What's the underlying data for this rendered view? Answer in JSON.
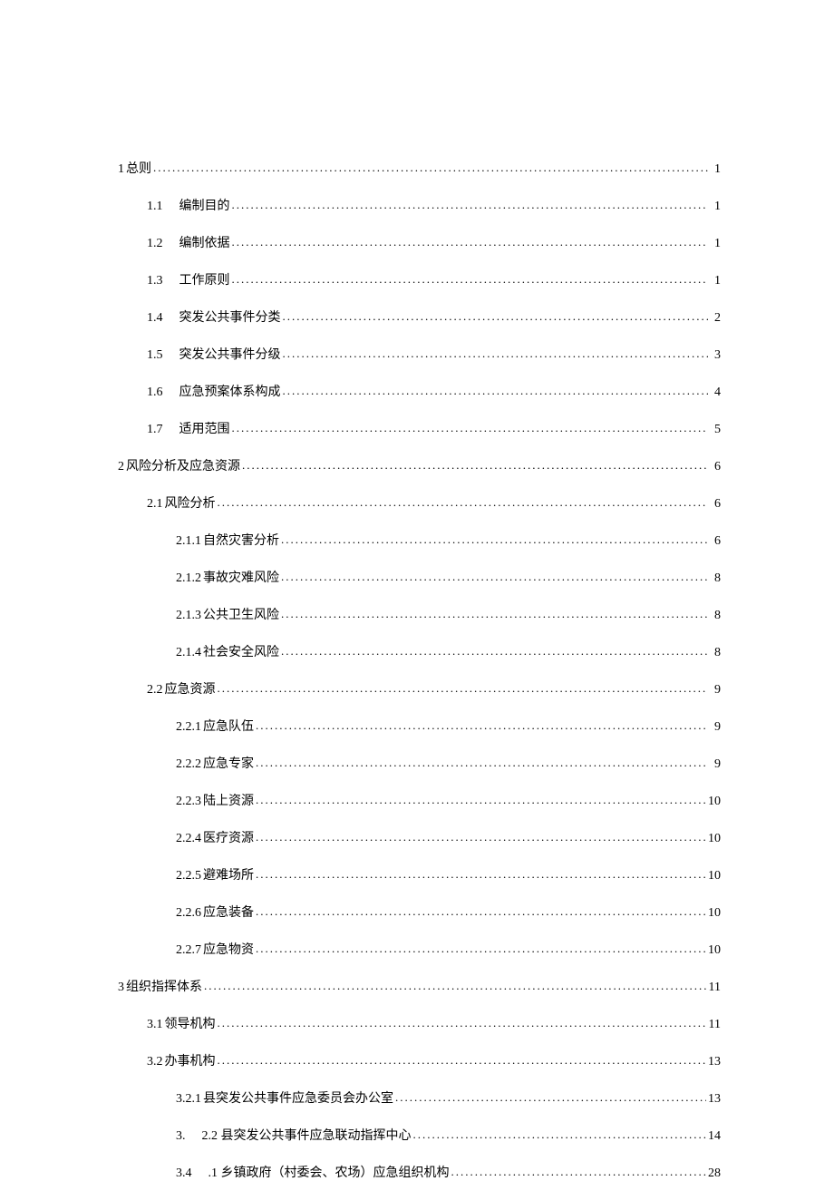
{
  "toc": [
    {
      "indent": 0,
      "num": "1",
      "title": "总则",
      "page": "1",
      "gap": "small"
    },
    {
      "indent": 1,
      "num": "1.1",
      "title": "编制目的",
      "page": "1",
      "gap": "wide"
    },
    {
      "indent": 1,
      "num": "1.2",
      "title": "编制依据",
      "page": "1",
      "gap": "wide"
    },
    {
      "indent": 1,
      "num": "1.3",
      "title": "工作原则",
      "page": "1",
      "gap": "wide"
    },
    {
      "indent": 1,
      "num": "1.4",
      "title": "突发公共事件分类",
      "page": "2",
      "gap": "wide"
    },
    {
      "indent": 1,
      "num": "1.5",
      "title": "突发公共事件分级",
      "page": "3",
      "gap": "wide"
    },
    {
      "indent": 1,
      "num": "1.6",
      "title": "应急预案体系构成",
      "page": "4",
      "gap": "wide"
    },
    {
      "indent": 1,
      "num": "1.7",
      "title": "适用范围",
      "page": "5",
      "gap": "wide"
    },
    {
      "indent": 0,
      "num": "2",
      "title": "风险分析及应急资源",
      "page": "6",
      "gap": "small"
    },
    {
      "indent": 1,
      "num": "2.1",
      "title": "风险分析",
      "page": "6",
      "gap": "small"
    },
    {
      "indent": 2,
      "num": "2.1.1",
      "title": "自然灾害分析",
      "page": "6",
      "gap": "small"
    },
    {
      "indent": 2,
      "num": "2.1.2",
      "title": "事故灾难风险",
      "page": "8",
      "gap": "small"
    },
    {
      "indent": 2,
      "num": "2.1.3",
      "title": "公共卫生风险",
      "page": "8",
      "gap": "small"
    },
    {
      "indent": 2,
      "num": "2.1.4",
      "title": "社会安全风险",
      "page": "8",
      "gap": "small"
    },
    {
      "indent": 1,
      "num": "2.2",
      "title": "应急资源",
      "page": "9",
      "gap": "small"
    },
    {
      "indent": 2,
      "num": "2.2.1",
      "title": "应急队伍",
      "page": "9",
      "gap": "small"
    },
    {
      "indent": 2,
      "num": "2.2.2",
      "title": "应急专家",
      "page": "9",
      "gap": "small"
    },
    {
      "indent": 2,
      "num": "2.2.3",
      "title": "陆上资源",
      "page": "10",
      "gap": "small"
    },
    {
      "indent": 2,
      "num": "2.2.4",
      "title": "医疗资源",
      "page": "10",
      "gap": "small"
    },
    {
      "indent": 2,
      "num": "2.2.5",
      "title": "避难场所",
      "page": "10",
      "gap": "small"
    },
    {
      "indent": 2,
      "num": "2.2.6",
      "title": "应急装备",
      "page": "10",
      "gap": "small"
    },
    {
      "indent": 2,
      "num": "2.2.7",
      "title": "应急物资",
      "page": "10",
      "gap": "small"
    },
    {
      "indent": 0,
      "num": "3",
      "title": "组织指挥体系",
      "page": "11",
      "gap": "small"
    },
    {
      "indent": 1,
      "num": "3.1",
      "title": "领导机构",
      "page": "11",
      "gap": "small"
    },
    {
      "indent": 1,
      "num": "3.2",
      "title": "办事机构",
      "page": "13",
      "gap": "small"
    },
    {
      "indent": 2,
      "num": "3.2.1",
      "title": "县突发公共事件应急委员会办公室",
      "page": "13",
      "gap": "small"
    },
    {
      "indent": 2,
      "num": "3.",
      "title": "2.2 县突发公共事件应急联动指挥中心",
      "page": "14",
      "gap": "wide"
    },
    {
      "indent": 2,
      "num": "3.4",
      "title": ".1 乡镇政府（村委会、农场）应急组织机构",
      "page": "28",
      "gap": "wide"
    }
  ]
}
